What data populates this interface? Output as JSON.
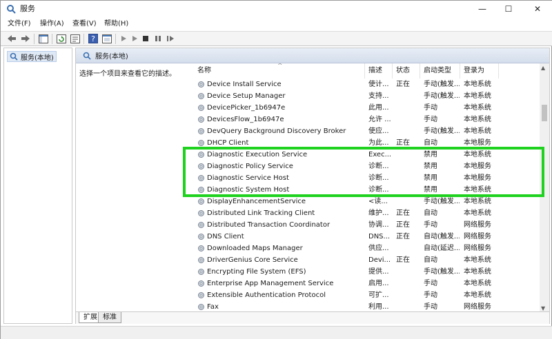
{
  "window": {
    "title": "服务"
  },
  "window_controls": {
    "minimize": "—",
    "maximize": "☐",
    "close": "✕"
  },
  "menu": [
    "文件(F)",
    "操作(A)",
    "查看(V)",
    "帮助(H)"
  ],
  "tree": {
    "root_label": "服务(本地)"
  },
  "pane": {
    "header_label": "服务(本地)",
    "description_prompt": "选择一个项目来查看它的描述。"
  },
  "list": {
    "columns": [
      "名称",
      "描述",
      "状态",
      "启动类型",
      "登录为"
    ],
    "rows": [
      {
        "name": "Device Install Service",
        "desc": "使计...",
        "status": "正在",
        "startup": "手动(触发...",
        "logon": "本地系统"
      },
      {
        "name": "Device Setup Manager",
        "desc": "支持...",
        "status": "",
        "startup": "手动(触发...",
        "logon": "本地系统"
      },
      {
        "name": "DevicePicker_1b6947e",
        "desc": "此用...",
        "status": "",
        "startup": "手动",
        "logon": "本地系统"
      },
      {
        "name": "DevicesFlow_1b6947e",
        "desc": "允许 ...",
        "status": "",
        "startup": "手动",
        "logon": "本地系统"
      },
      {
        "name": "DevQuery Background Discovery Broker",
        "desc": "使应...",
        "status": "",
        "startup": "手动(触发...",
        "logon": "本地系统"
      },
      {
        "name": "DHCP Client",
        "desc": "为此...",
        "status": "正在",
        "startup": "自动",
        "logon": "本地服务"
      },
      {
        "name": "Diagnostic Execution Service",
        "desc": "Exec...",
        "status": "",
        "startup": "禁用",
        "logon": "本地系统"
      },
      {
        "name": "Diagnostic Policy Service",
        "desc": "诊断...",
        "status": "",
        "startup": "禁用",
        "logon": "本地服务"
      },
      {
        "name": "Diagnostic Service Host",
        "desc": "诊断...",
        "status": "",
        "startup": "禁用",
        "logon": "本地服务"
      },
      {
        "name": "Diagnostic System Host",
        "desc": "诊断...",
        "status": "",
        "startup": "禁用",
        "logon": "本地系统"
      },
      {
        "name": "DisplayEnhancementService",
        "desc": "<读...",
        "status": "",
        "startup": "手动(触发...",
        "logon": "本地系统"
      },
      {
        "name": "Distributed Link Tracking Client",
        "desc": "维护...",
        "status": "正在",
        "startup": "自动",
        "logon": "本地系统"
      },
      {
        "name": "Distributed Transaction Coordinator",
        "desc": "协调...",
        "status": "正在",
        "startup": "手动",
        "logon": "网络服务"
      },
      {
        "name": "DNS Client",
        "desc": "DNS...",
        "status": "正在",
        "startup": "自动(触发...",
        "logon": "网络服务"
      },
      {
        "name": "Downloaded Maps Manager",
        "desc": "供应...",
        "status": "",
        "startup": "自动(延迟...",
        "logon": "网络服务"
      },
      {
        "name": "DriverGenius Core Service",
        "desc": "Devi...",
        "status": "正在",
        "startup": "自动",
        "logon": "本地系统"
      },
      {
        "name": "Encrypting File System (EFS)",
        "desc": "提供...",
        "status": "",
        "startup": "手动(触发...",
        "logon": "本地系统"
      },
      {
        "name": "Enterprise App Management Service",
        "desc": "启用...",
        "status": "",
        "startup": "手动",
        "logon": "本地系统"
      },
      {
        "name": "Extensible Authentication Protocol",
        "desc": "可扩...",
        "status": "",
        "startup": "手动",
        "logon": "本地系统"
      },
      {
        "name": "Fax",
        "desc": "利用...",
        "status": "",
        "startup": "手动",
        "logon": "网络服务"
      }
    ]
  },
  "tabs": [
    "扩展",
    "标准"
  ],
  "colors": {
    "highlight": "#1fd21f",
    "selection": "#dfe8f5"
  }
}
